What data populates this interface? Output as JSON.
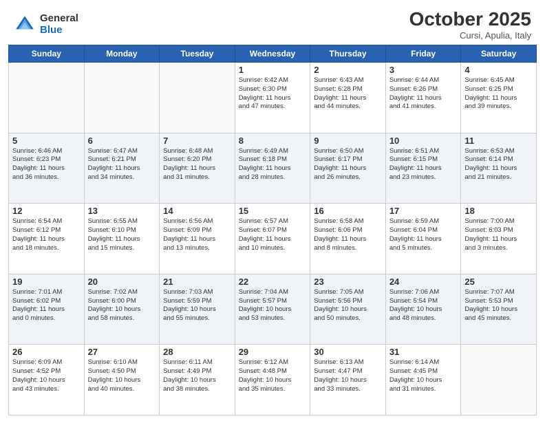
{
  "logo": {
    "general": "General",
    "blue": "Blue"
  },
  "header": {
    "month": "October 2025",
    "location": "Cursi, Apulia, Italy"
  },
  "weekdays": [
    "Sunday",
    "Monday",
    "Tuesday",
    "Wednesday",
    "Thursday",
    "Friday",
    "Saturday"
  ],
  "weeks": [
    [
      {
        "num": "",
        "info": ""
      },
      {
        "num": "",
        "info": ""
      },
      {
        "num": "",
        "info": ""
      },
      {
        "num": "1",
        "info": "Sunrise: 6:42 AM\nSunset: 6:30 PM\nDaylight: 11 hours\nand 47 minutes."
      },
      {
        "num": "2",
        "info": "Sunrise: 6:43 AM\nSunset: 6:28 PM\nDaylight: 11 hours\nand 44 minutes."
      },
      {
        "num": "3",
        "info": "Sunrise: 6:44 AM\nSunset: 6:26 PM\nDaylight: 11 hours\nand 41 minutes."
      },
      {
        "num": "4",
        "info": "Sunrise: 6:45 AM\nSunset: 6:25 PM\nDaylight: 11 hours\nand 39 minutes."
      }
    ],
    [
      {
        "num": "5",
        "info": "Sunrise: 6:46 AM\nSunset: 6:23 PM\nDaylight: 11 hours\nand 36 minutes."
      },
      {
        "num": "6",
        "info": "Sunrise: 6:47 AM\nSunset: 6:21 PM\nDaylight: 11 hours\nand 34 minutes."
      },
      {
        "num": "7",
        "info": "Sunrise: 6:48 AM\nSunset: 6:20 PM\nDaylight: 11 hours\nand 31 minutes."
      },
      {
        "num": "8",
        "info": "Sunrise: 6:49 AM\nSunset: 6:18 PM\nDaylight: 11 hours\nand 28 minutes."
      },
      {
        "num": "9",
        "info": "Sunrise: 6:50 AM\nSunset: 6:17 PM\nDaylight: 11 hours\nand 26 minutes."
      },
      {
        "num": "10",
        "info": "Sunrise: 6:51 AM\nSunset: 6:15 PM\nDaylight: 11 hours\nand 23 minutes."
      },
      {
        "num": "11",
        "info": "Sunrise: 6:53 AM\nSunset: 6:14 PM\nDaylight: 11 hours\nand 21 minutes."
      }
    ],
    [
      {
        "num": "12",
        "info": "Sunrise: 6:54 AM\nSunset: 6:12 PM\nDaylight: 11 hours\nand 18 minutes."
      },
      {
        "num": "13",
        "info": "Sunrise: 6:55 AM\nSunset: 6:10 PM\nDaylight: 11 hours\nand 15 minutes."
      },
      {
        "num": "14",
        "info": "Sunrise: 6:56 AM\nSunset: 6:09 PM\nDaylight: 11 hours\nand 13 minutes."
      },
      {
        "num": "15",
        "info": "Sunrise: 6:57 AM\nSunset: 6:07 PM\nDaylight: 11 hours\nand 10 minutes."
      },
      {
        "num": "16",
        "info": "Sunrise: 6:58 AM\nSunset: 6:06 PM\nDaylight: 11 hours\nand 8 minutes."
      },
      {
        "num": "17",
        "info": "Sunrise: 6:59 AM\nSunset: 6:04 PM\nDaylight: 11 hours\nand 5 minutes."
      },
      {
        "num": "18",
        "info": "Sunrise: 7:00 AM\nSunset: 6:03 PM\nDaylight: 11 hours\nand 3 minutes."
      }
    ],
    [
      {
        "num": "19",
        "info": "Sunrise: 7:01 AM\nSunset: 6:02 PM\nDaylight: 11 hours\nand 0 minutes."
      },
      {
        "num": "20",
        "info": "Sunrise: 7:02 AM\nSunset: 6:00 PM\nDaylight: 10 hours\nand 58 minutes."
      },
      {
        "num": "21",
        "info": "Sunrise: 7:03 AM\nSunset: 5:59 PM\nDaylight: 10 hours\nand 55 minutes."
      },
      {
        "num": "22",
        "info": "Sunrise: 7:04 AM\nSunset: 5:57 PM\nDaylight: 10 hours\nand 53 minutes."
      },
      {
        "num": "23",
        "info": "Sunrise: 7:05 AM\nSunset: 5:56 PM\nDaylight: 10 hours\nand 50 minutes."
      },
      {
        "num": "24",
        "info": "Sunrise: 7:06 AM\nSunset: 5:54 PM\nDaylight: 10 hours\nand 48 minutes."
      },
      {
        "num": "25",
        "info": "Sunrise: 7:07 AM\nSunset: 5:53 PM\nDaylight: 10 hours\nand 45 minutes."
      }
    ],
    [
      {
        "num": "26",
        "info": "Sunrise: 6:09 AM\nSunset: 4:52 PM\nDaylight: 10 hours\nand 43 minutes."
      },
      {
        "num": "27",
        "info": "Sunrise: 6:10 AM\nSunset: 4:50 PM\nDaylight: 10 hours\nand 40 minutes."
      },
      {
        "num": "28",
        "info": "Sunrise: 6:11 AM\nSunset: 4:49 PM\nDaylight: 10 hours\nand 38 minutes."
      },
      {
        "num": "29",
        "info": "Sunrise: 6:12 AM\nSunset: 4:48 PM\nDaylight: 10 hours\nand 35 minutes."
      },
      {
        "num": "30",
        "info": "Sunrise: 6:13 AM\nSunset: 4:47 PM\nDaylight: 10 hours\nand 33 minutes."
      },
      {
        "num": "31",
        "info": "Sunrise: 6:14 AM\nSunset: 4:45 PM\nDaylight: 10 hours\nand 31 minutes."
      },
      {
        "num": "",
        "info": ""
      }
    ]
  ]
}
